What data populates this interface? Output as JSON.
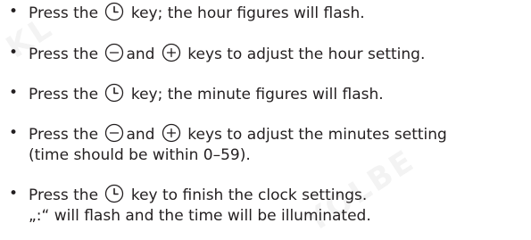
{
  "watermark": {
    "left_text": "KL",
    "right_text": "YOLBE"
  },
  "icons": {
    "clock": "clock-key-icon",
    "minus": "minus-key-icon",
    "plus": "plus-key-icon"
  },
  "colors": {
    "text": "#231f20",
    "watermark": "#f3f3f3"
  },
  "bullets": [
    {
      "pre": "Press the",
      "post": "key; the hour figures will flash."
    },
    {
      "pre": "Press the",
      "mid": "and",
      "post": "keys to adjust the hour setting."
    },
    {
      "pre": "Press the",
      "post": "key; the minute figures will flash."
    },
    {
      "pre": "Press the",
      "mid": "and",
      "post": "keys to adjust the minutes setting",
      "line2": "(time should be within 0–59)."
    },
    {
      "pre": "Press the",
      "post": "key to finish the clock settings.",
      "line2": "„:“ will flash and the time will be illuminated."
    }
  ]
}
